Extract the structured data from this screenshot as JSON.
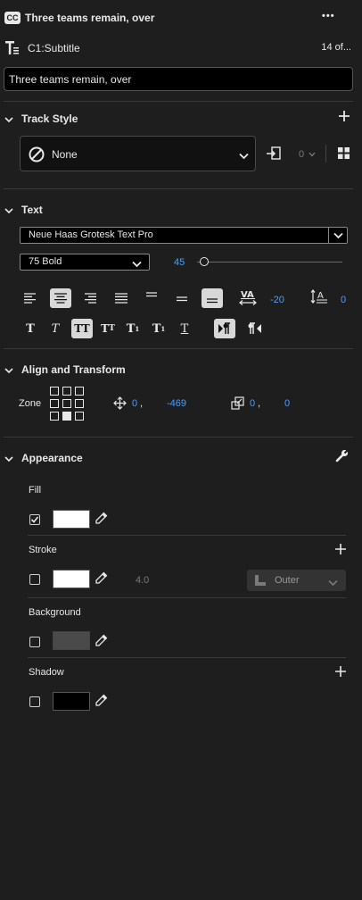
{
  "header": {
    "badge": "CC",
    "title": "Three teams remain, over",
    "more": "•••"
  },
  "subtitle_row": {
    "label": "C1:Subtitle",
    "count": "14 of..."
  },
  "caption_text": "Three teams remain, over",
  "track_style": {
    "title": "Track Style",
    "value": "None",
    "num": "0"
  },
  "text": {
    "title": "Text",
    "font_family": "Neue Haas Grotesk Text Pro",
    "font_style": "75 Bold",
    "font_size": "45",
    "font_size_fraction": 0.05,
    "tracking": "-20",
    "leading": "0"
  },
  "align_transform": {
    "title": "Align and Transform",
    "zone_label": "Zone",
    "pos_x": "0",
    "pos_comma": ",",
    "pos_y": "-469",
    "scale_x": "0",
    "scale_comma": ",",
    "scale_y": "0"
  },
  "appearance": {
    "title": "Appearance",
    "fill": {
      "label": "Fill",
      "checked": true,
      "color": "#ffffff"
    },
    "stroke": {
      "label": "Stroke",
      "checked": false,
      "color": "#ffffff",
      "width": "4.0",
      "position": "Outer"
    },
    "background": {
      "label": "Background",
      "checked": false,
      "color": "#4a4a4a"
    },
    "shadow": {
      "label": "Shadow",
      "checked": false,
      "color": "#000000"
    }
  }
}
